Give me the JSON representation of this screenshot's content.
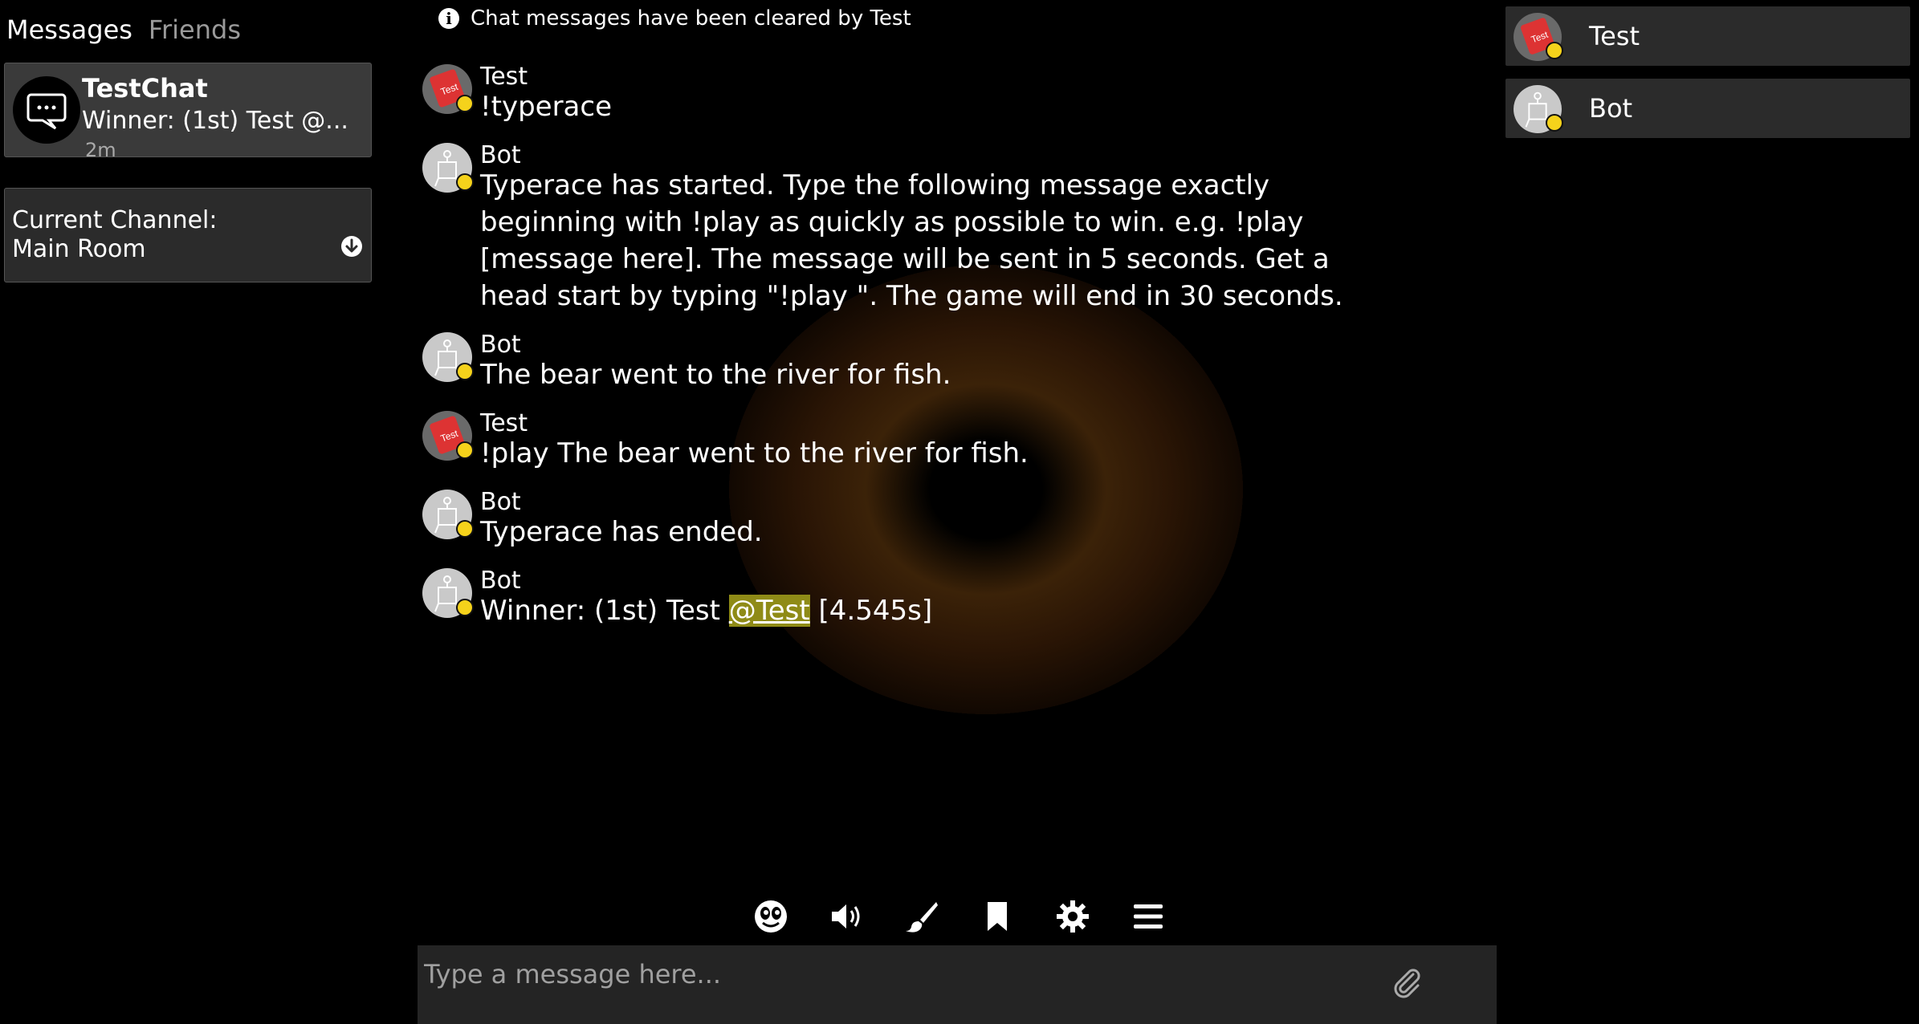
{
  "sidebar": {
    "tabs": [
      {
        "label": "Messages"
      },
      {
        "label": "Friends"
      }
    ],
    "chat": {
      "name": "TestChat",
      "preview": "Winner: (1st) Test @...",
      "time": "2m"
    },
    "channel": {
      "label": "Current Channel:",
      "name": "Main Room"
    }
  },
  "notice": {
    "text": "Chat messages have been cleared by Test",
    "icon": "info-icon"
  },
  "messages": [
    {
      "author": "Test",
      "text": "!typerace"
    },
    {
      "author": "Bot",
      "text": "Typerace has started. Type the following message exactly beginning with !play as quickly as possible to win. e.g. !play [message here]. The message will be sent in 5 seconds. Get a head start by typing \"!play \". The game will end in 30 seconds."
    },
    {
      "author": "Bot",
      "text": "The bear went to the river for fish."
    },
    {
      "author": "Test",
      "text": "!play The bear went to the river for fish."
    },
    {
      "author": "Bot",
      "text": "Typerace has ended."
    },
    {
      "author": "Bot",
      "text_before": "Winner: (1st) Test ",
      "mention": "@Test",
      "text_after": " [4.545s]"
    }
  ],
  "toolbar": {
    "icons": [
      "emoji-icon",
      "volume-icon",
      "brush-icon",
      "bookmark-icon",
      "gear-icon",
      "menu-icon"
    ]
  },
  "composer": {
    "placeholder": "Type a message here...",
    "icon": "paperclip-icon"
  },
  "users": [
    {
      "name": "Test"
    },
    {
      "name": "Bot"
    }
  ],
  "colors": {
    "status": "#f5d21b",
    "mention_bg": "#8f8b17",
    "panel": "#2b2b2b"
  }
}
